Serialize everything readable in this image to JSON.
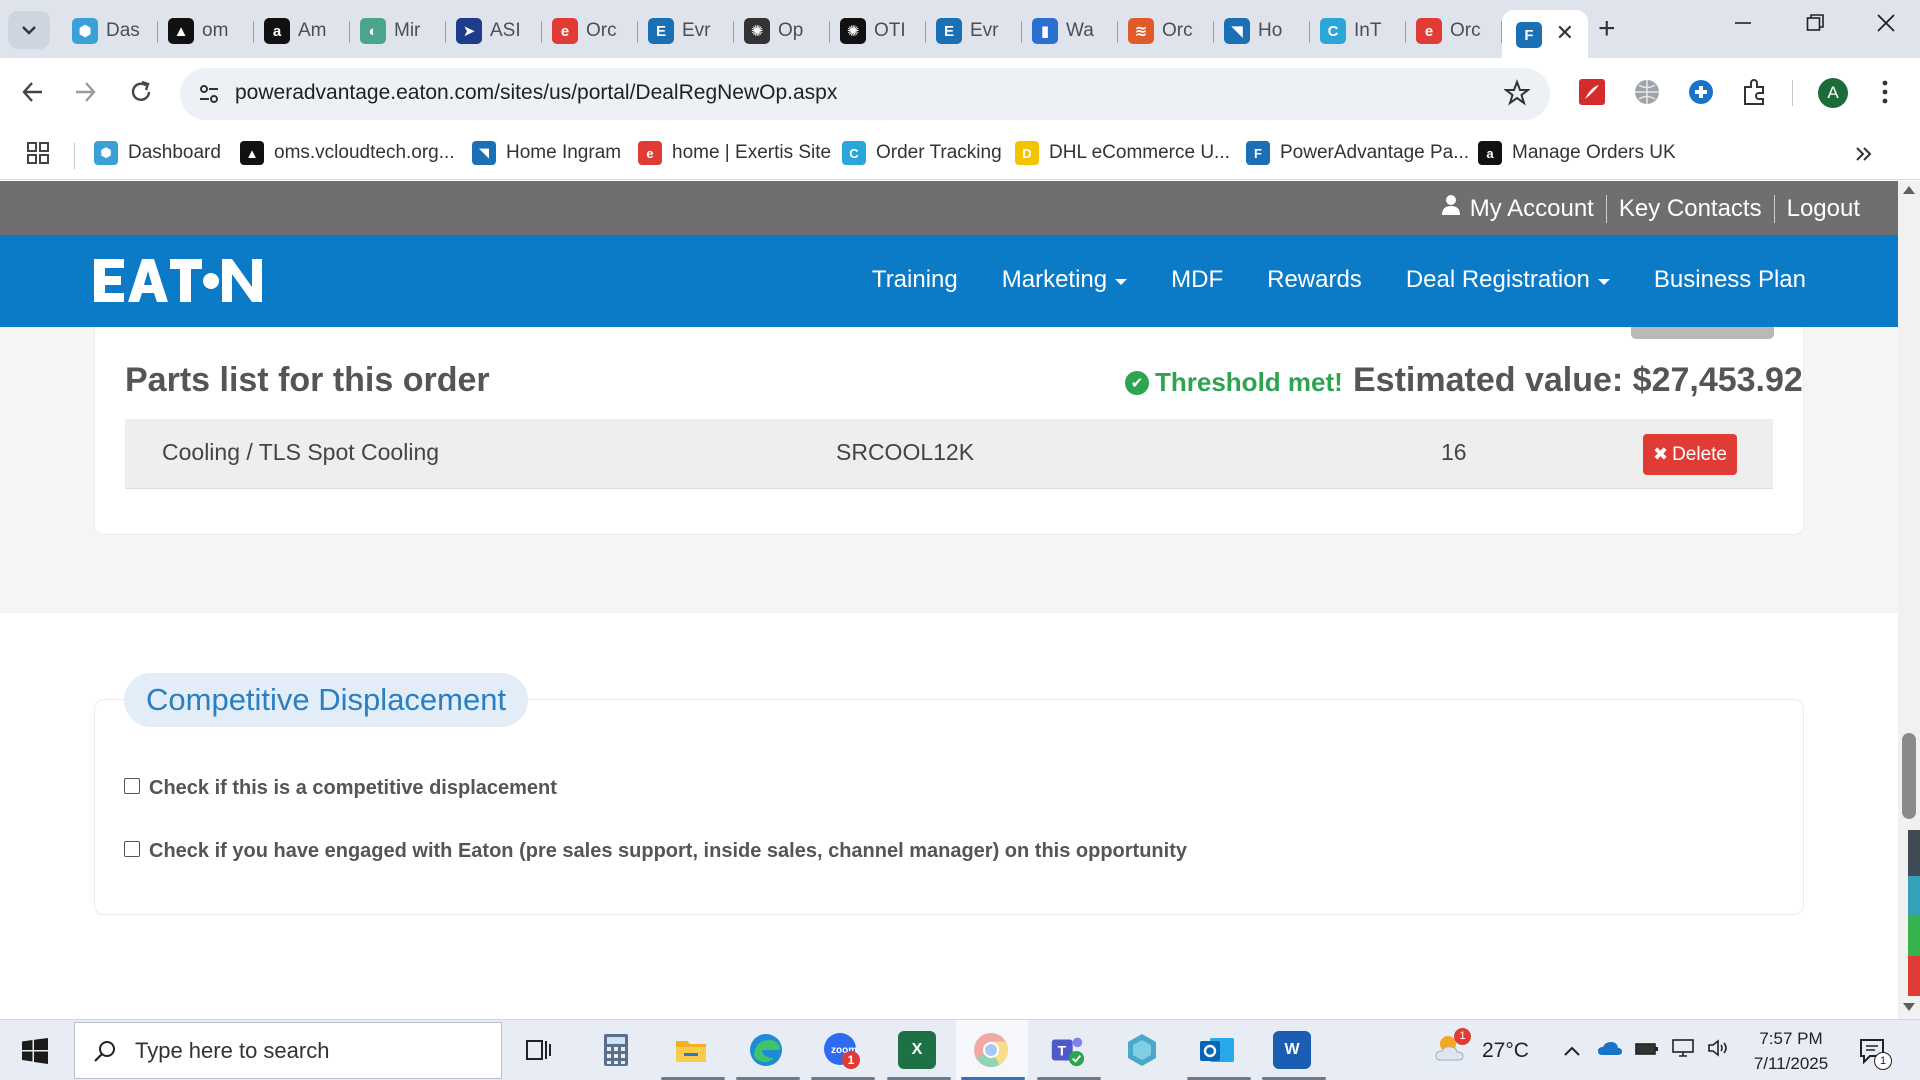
{
  "browser": {
    "tabs": [
      {
        "title": "Das",
        "icon": "hexagon-icon",
        "color": "#3aa0d8"
      },
      {
        "title": "om",
        "icon": "vcloud-icon",
        "color": "#111111"
      },
      {
        "title": "Am",
        "icon": "amazon-icon",
        "color": "#111111"
      },
      {
        "title": "Mir",
        "icon": "mirakl-icon",
        "color": "#4aa58c"
      },
      {
        "title": "ASI",
        "icon": "arrow-play-icon",
        "color": "#1e3c8c"
      },
      {
        "title": "Orc",
        "icon": "exertis-icon",
        "color": "#e03b34"
      },
      {
        "title": "Evr",
        "icon": "e-icon",
        "color": "#1b6fb5"
      },
      {
        "title": "Op",
        "icon": "openai-icon",
        "color": "#333333"
      },
      {
        "title": "OTI",
        "icon": "openai-dark-icon",
        "color": "#111111"
      },
      {
        "title": "Evr",
        "icon": "e-icon",
        "color": "#1b6fb5"
      },
      {
        "title": "Wa",
        "icon": "chart-bars-icon",
        "color": "#2a6fd1"
      },
      {
        "title": "Orc",
        "icon": "stack-icon",
        "color": "#e05a2a"
      },
      {
        "title": "Ho",
        "icon": "ingram-icon",
        "color": "#1b6fb5"
      },
      {
        "title": "InT",
        "icon": "c-circle-icon",
        "color": "#2aa6d8"
      },
      {
        "title": "Orc",
        "icon": "exertis-icon",
        "color": "#e03b34"
      }
    ],
    "active_tab": {
      "icon": "powerad-icon",
      "color": "#1b6fb5",
      "close_glyph": "✕"
    },
    "new_tab_glyph": "+",
    "url": "poweradvantage.eaton.com/sites/us/portal/DealRegNewOp.aspx",
    "avatar_letter": "A",
    "bookmarks": [
      {
        "label": "Dashboard",
        "icon": "hexagon-icon",
        "color": "#3aa0d8"
      },
      {
        "label": "oms.vcloudtech.org...",
        "icon": "vcloud-icon",
        "color": "#111111"
      },
      {
        "label": "Home Ingram",
        "icon": "ingram-icon",
        "color": "#1b6fb5"
      },
      {
        "label": "home | Exertis Site",
        "icon": "exertis-icon",
        "color": "#e03b34"
      },
      {
        "label": "Order Tracking",
        "icon": "c-circle-icon",
        "color": "#2aa6d8"
      },
      {
        "label": "DHL eCommerce U...",
        "icon": "dhl-icon",
        "color": "#f5c400"
      },
      {
        "label": "PowerAdvantage Pa...",
        "icon": "powerad-icon",
        "color": "#1b6fb5"
      },
      {
        "label": "Manage Orders UK",
        "icon": "amazon-icon",
        "color": "#111111"
      }
    ]
  },
  "site": {
    "util_links": {
      "account": "My Account",
      "contacts": "Key Contacts",
      "logout": "Logout"
    },
    "logo_text": "EATON",
    "nav": {
      "training": "Training",
      "marketing": "Marketing",
      "mdf": "MDF",
      "rewards": "Rewards",
      "deal_registration": "Deal Registration",
      "business_plan": "Business Plan"
    },
    "colors": {
      "nav_blue": "#0b7bc8",
      "util_gray": "#6f6f6f",
      "success_green": "#2ea44f",
      "danger_red": "#e03b34"
    }
  },
  "parts": {
    "title": "Parts list for this order",
    "threshold": "Threshold met!",
    "estimated": "Estimated value: $27,453.92",
    "rows": [
      {
        "category": "Cooling / TLS Spot Cooling",
        "sku": "SRCOOL12K",
        "qty": "16",
        "delete_label": "Delete"
      }
    ]
  },
  "competitive": {
    "legend": "Competitive Displacement",
    "check1": "Check if this is a competitive displacement",
    "check2": "Check if you have engaged with Eaton (pre sales support, inside sales, channel manager) on this opportunity"
  },
  "taskbar": {
    "search_placeholder": "Type here to search",
    "weather_temp": "27°C",
    "weather_badge": "1",
    "time": "7:57 PM",
    "date": "7/11/2025",
    "notification_count": "1",
    "zoom_badge": "1"
  }
}
